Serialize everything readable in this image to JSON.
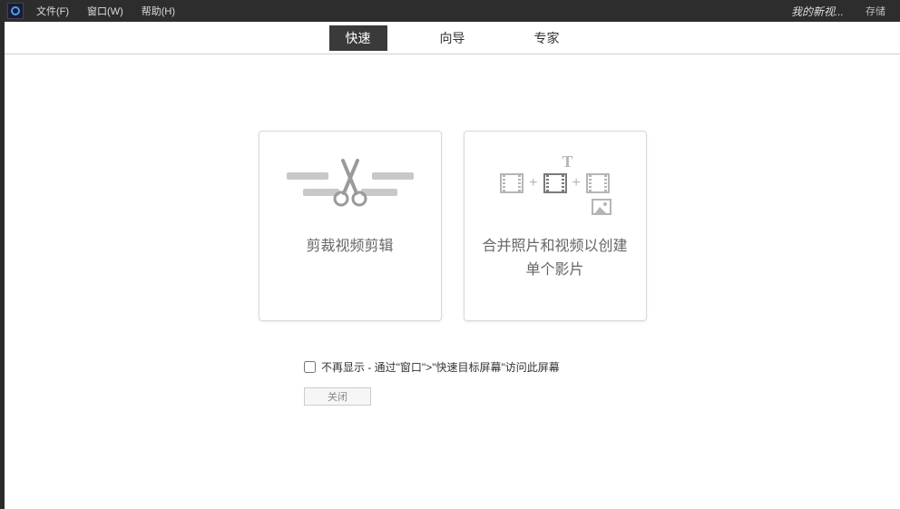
{
  "menu": {
    "file": "文件(F)",
    "window": "窗口(W)",
    "help": "帮助(H)"
  },
  "header": {
    "project_name": "我的新视...",
    "save": "存储"
  },
  "tabs": {
    "quick": "快速",
    "guided": "向导",
    "expert": "专家"
  },
  "cards": {
    "trim": "剪裁视频剪辑",
    "merge": "合并照片和视频以创建单个影片"
  },
  "footer": {
    "checkbox_label": "不再显示 - 通过\"窗口\">\"快速目标屏幕\"访问此屏幕",
    "close": "关闭"
  }
}
